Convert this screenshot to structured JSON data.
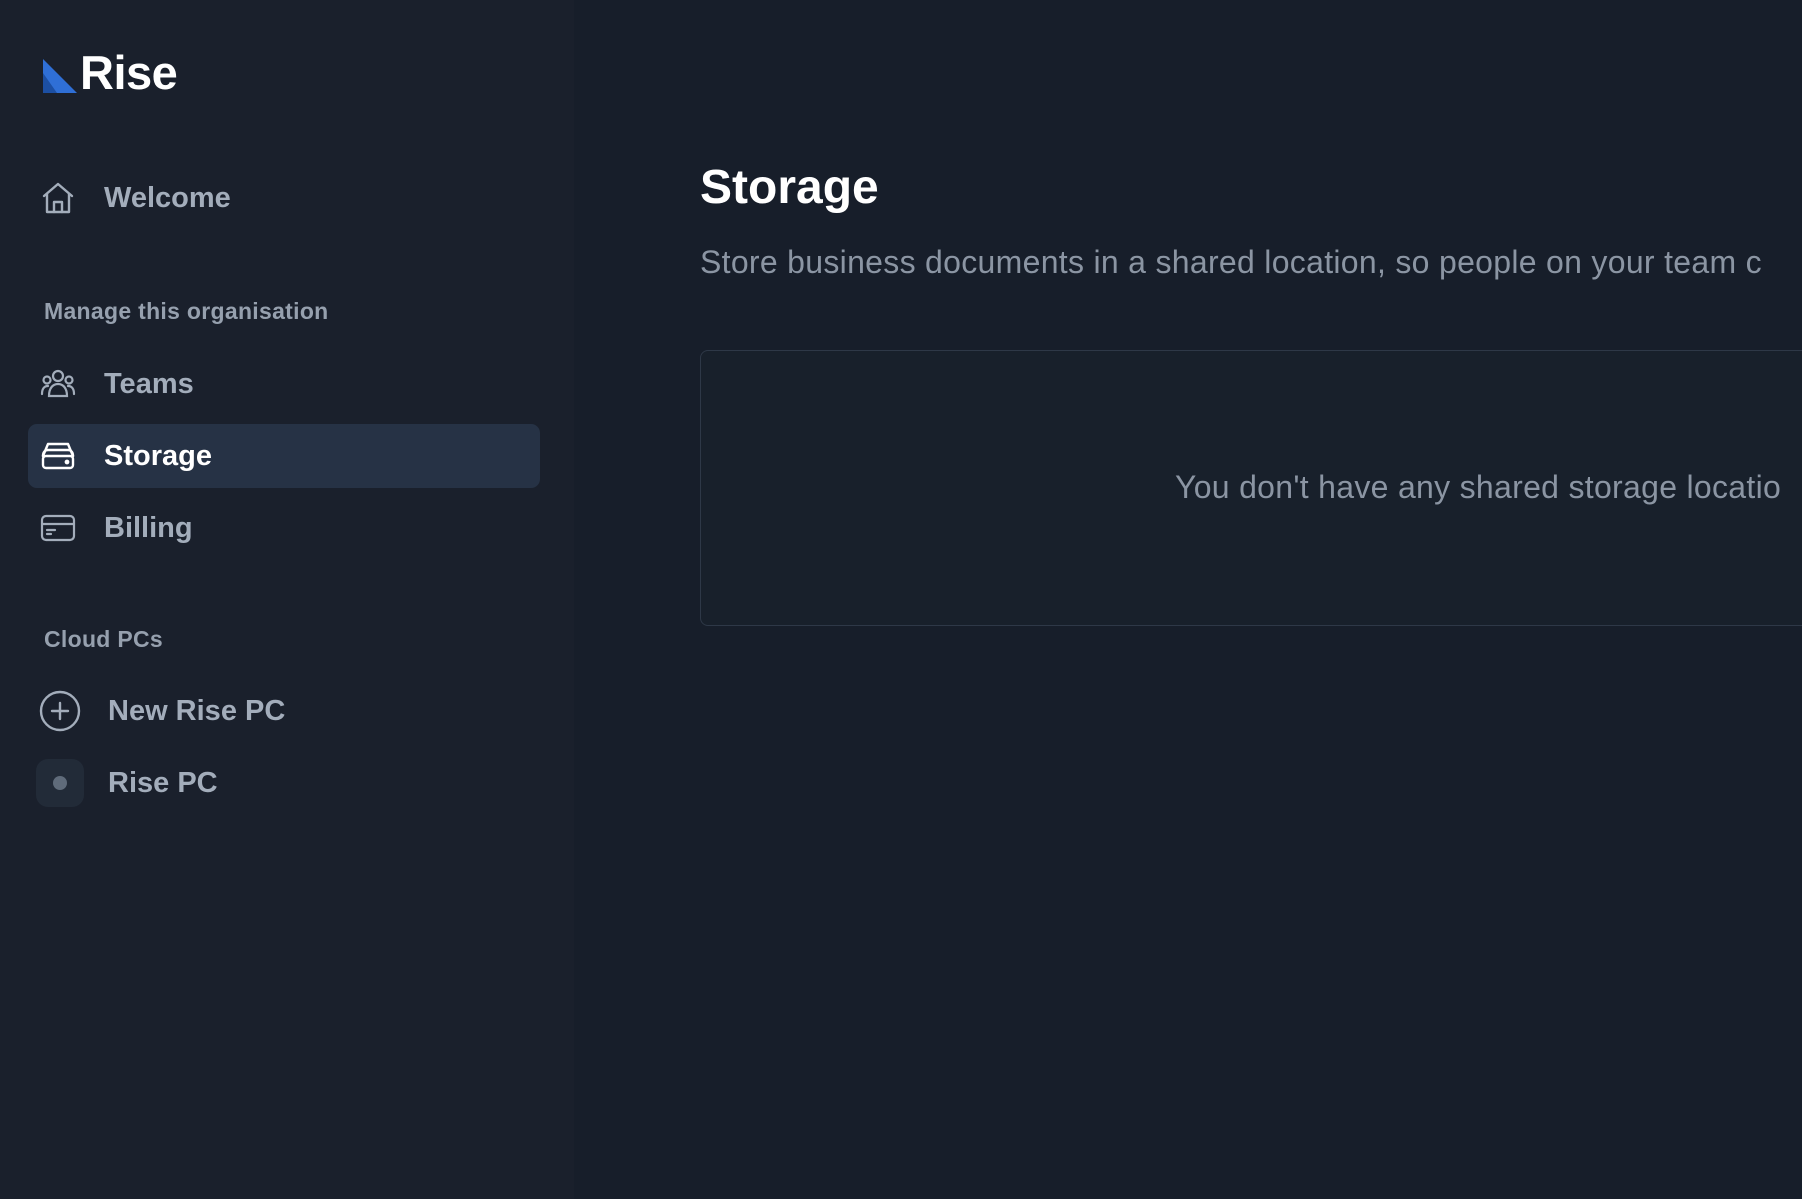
{
  "app": {
    "name": "Rise",
    "accent_color": "#2f6fd6"
  },
  "sidebar": {
    "welcome": {
      "label": "Welcome",
      "icon": "home-icon"
    },
    "manage_section": {
      "title": "Manage this organisation",
      "items": [
        {
          "label": "Teams",
          "icon": "users-icon",
          "active": false
        },
        {
          "label": "Storage",
          "icon": "storage-icon",
          "active": true
        },
        {
          "label": "Billing",
          "icon": "credit-card-icon",
          "active": false
        }
      ]
    },
    "cloud_section": {
      "title": "Cloud PCs",
      "items": [
        {
          "label": "New Rise PC",
          "icon": "plus-circle-icon"
        },
        {
          "label": "Rise PC",
          "icon": "status-dot-icon",
          "status_color": "#5f6b7a"
        }
      ]
    }
  },
  "main": {
    "title": "Storage",
    "description": "Store business documents in a shared location, so people on your team c",
    "empty_state": "You don't have any shared storage locatio"
  }
}
